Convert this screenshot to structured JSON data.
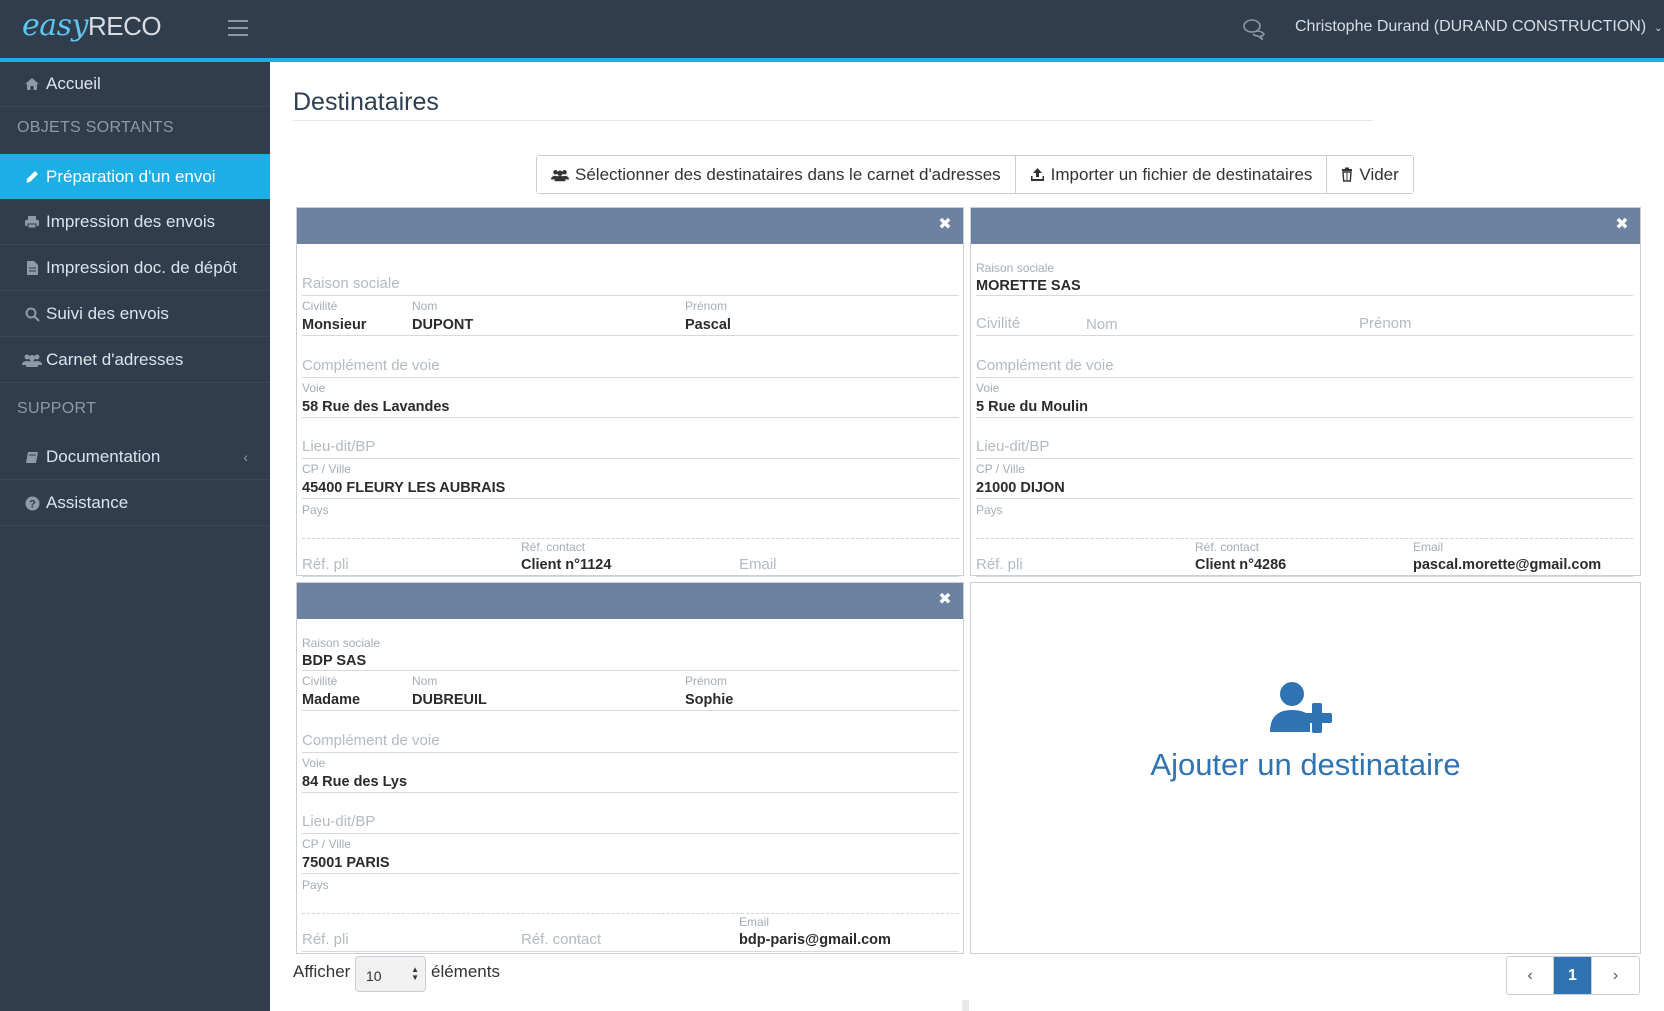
{
  "header": {
    "logo_easy": "easy",
    "logo_reco": "RECO",
    "user": "Christophe Durand (DURAND CONSTRUCTION)"
  },
  "sidebar": {
    "home": "Accueil",
    "section_outgoing": "OBJETS SORTANTS",
    "items": [
      {
        "label": "Préparation d'un envoi",
        "icon": "pencil-icon"
      },
      {
        "label": "Impression des envois",
        "icon": "printer-icon"
      },
      {
        "label": "Impression doc. de dépôt",
        "icon": "file-icon"
      },
      {
        "label": "Suivi des envois",
        "icon": "search-icon"
      },
      {
        "label": "Carnet d'adresses",
        "icon": "users-icon"
      }
    ],
    "section_support": "SUPPORT",
    "support_items": [
      {
        "label": "Documentation",
        "icon": "book-icon"
      },
      {
        "label": "Assistance",
        "icon": "question-icon"
      }
    ]
  },
  "main": {
    "title": "Destinataires",
    "buttons": {
      "select": "Sélectionner des destinataires dans le carnet d'adresses",
      "import": "Importer un fichier de destinataires",
      "clear": "Vider"
    },
    "labels": {
      "raison_sociale": "Raison sociale",
      "civilite": "Civilité",
      "nom": "Nom",
      "prenom": "Prénom",
      "complement": "Complément de voie",
      "voie": "Voie",
      "lieu_dit": "Lieu-dit/BP",
      "cp_ville": "CP / Ville",
      "pays": "Pays",
      "ref_pli": "Réf. pli",
      "ref_contact": "Réf. contact",
      "email": "Email"
    },
    "recipients": [
      {
        "raison_sociale": "",
        "civilite": "Monsieur",
        "nom": "DUPONT",
        "prenom": "Pascal",
        "complement": "",
        "voie": "58 Rue des Lavandes",
        "lieu_dit": "",
        "cp_ville": "45400 FLEURY LES AUBRAIS",
        "pays": "",
        "ref_pli": "",
        "ref_contact": "Client n°1124",
        "email": ""
      },
      {
        "raison_sociale": "MORETTE SAS",
        "civilite": "",
        "nom": "",
        "prenom": "",
        "complement": "",
        "voie": "5 Rue du Moulin",
        "lieu_dit": "",
        "cp_ville": "21000 DIJON",
        "pays": "",
        "ref_pli": "",
        "ref_contact": "Client n°4286",
        "email": "pascal.morette@gmail.com"
      },
      {
        "raison_sociale": "BDP SAS",
        "civilite": "Madame",
        "nom": "DUBREUIL",
        "prenom": "Sophie",
        "complement": "",
        "voie": "84 Rue des Lys",
        "lieu_dit": "",
        "cp_ville": "75001 PARIS",
        "pays": "",
        "ref_pli": "",
        "ref_contact": "",
        "email": "bdp-paris@gmail.com"
      }
    ],
    "add_recipient": "Ajouter un destinataire"
  },
  "footer": {
    "show": "Afficher",
    "page_size": "10",
    "elements": "éléments",
    "prev": "‹",
    "current_page": "1",
    "next": "›"
  },
  "colors": {
    "sidebar": "#2f3d4d",
    "accent": "#1eaee6",
    "card_header": "#6c82a0",
    "link_blue": "#2f73b3"
  }
}
